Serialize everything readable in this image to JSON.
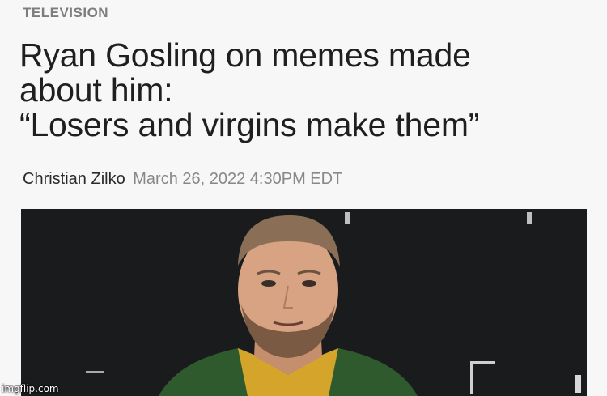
{
  "article": {
    "category": "TELEVISION",
    "headline_lines": [
      "Ryan Gosling on memes made",
      "about him:",
      "“Losers and virgins make them”"
    ],
    "author": "Christian Zilko",
    "date": "March 26, 2022 4:30PM EDT"
  },
  "watermark": "imgflip.com",
  "colors": {
    "category": "#7d7d7d",
    "headline": "#1f1f1f",
    "date": "#888888",
    "photo_background": "#1a1b1d",
    "jacket": "#2e5a2e",
    "shirt": "#d4a52a"
  }
}
